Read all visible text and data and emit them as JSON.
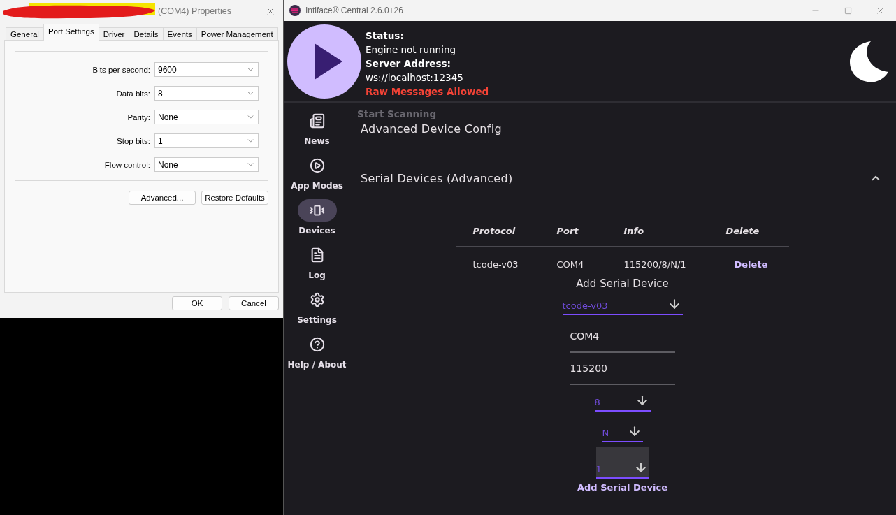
{
  "properties_dialog": {
    "title": "(COM4) Properties",
    "tabs": [
      {
        "label": "General",
        "selected": false
      },
      {
        "label": "Port Settings",
        "selected": true
      },
      {
        "label": "Driver",
        "selected": false
      },
      {
        "label": "Details",
        "selected": false
      },
      {
        "label": "Events",
        "selected": false
      },
      {
        "label": "Power Management",
        "selected": false
      }
    ],
    "fields": [
      {
        "label": "Bits per second:",
        "value": "9600"
      },
      {
        "label": "Data bits:",
        "value": "8"
      },
      {
        "label": "Parity:",
        "value": "None"
      },
      {
        "label": "Stop bits:",
        "value": "1"
      },
      {
        "label": "Flow control:",
        "value": "None"
      }
    ],
    "panel_buttons": [
      "Advanced...",
      "Restore Defaults"
    ],
    "footer_buttons": [
      "OK",
      "Cancel"
    ]
  },
  "app_window": {
    "title": "Intiface® Central 2.6.0+26",
    "status": {
      "status_label": "Status:",
      "status_value": "Engine not running",
      "address_label": "Server Address:",
      "address_value": "ws://localhost:12345",
      "warning": "Raw Messages Allowed"
    },
    "nav": [
      {
        "label": "News",
        "selected": false
      },
      {
        "label": "App Modes",
        "selected": false
      },
      {
        "label": "Devices",
        "selected": true
      },
      {
        "label": "Log",
        "selected": false
      },
      {
        "label": "Settings",
        "selected": false
      },
      {
        "label": "Help / About",
        "selected": false
      }
    ],
    "scan_button": {
      "label": "Start Scanning",
      "disabled": true
    },
    "sections": [
      {
        "title": "Advanced Device Config",
        "expanded": false
      },
      {
        "title": "Serial Devices (Advanced)",
        "expanded": true
      }
    ],
    "table": {
      "columns": [
        "Protocol",
        "Port",
        "Info",
        "Delete"
      ],
      "rows": [
        {
          "protocol": "tcode-v03",
          "port": "COM4",
          "info": "115200/8/N/1",
          "action": "Delete"
        }
      ]
    },
    "add_form": {
      "title": "Add Serial Device",
      "fields": [
        {
          "kind": "select",
          "value": "tcode-v03",
          "focused": false
        },
        {
          "kind": "text",
          "value": "COM4",
          "focused": false
        },
        {
          "kind": "text",
          "value": "115200",
          "focused": false
        },
        {
          "kind": "select",
          "value": "8",
          "focused": false
        },
        {
          "kind": "select",
          "value": "N",
          "focused": false
        },
        {
          "kind": "select",
          "value": "1",
          "focused": true
        }
      ],
      "submit": "Add Serial Device"
    }
  }
}
